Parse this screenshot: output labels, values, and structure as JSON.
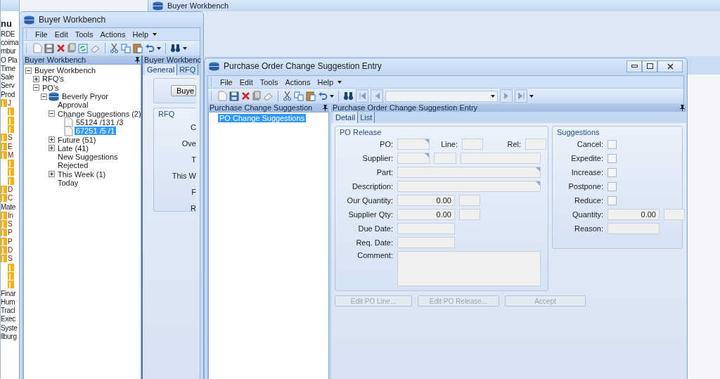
{
  "back_window": {
    "title": "Buyer Workbench"
  },
  "menu_window": {
    "title": "nu",
    "items": [
      {
        "kind": "text",
        "label": "RDE"
      },
      {
        "kind": "text",
        "label": "coima"
      },
      {
        "kind": "text",
        "label": "mbur"
      },
      {
        "kind": "text",
        "label": "O Pla"
      },
      {
        "kind": "text",
        "label": "Time"
      },
      {
        "kind": "text",
        "label": "Sale"
      },
      {
        "kind": "text",
        "label": "Serv"
      },
      {
        "kind": "text",
        "label": "Prod"
      },
      {
        "kind": "folder",
        "label": "J"
      },
      {
        "kind": "subfolder"
      },
      {
        "kind": "subfolder"
      },
      {
        "kind": "subfolder"
      },
      {
        "kind": "folder",
        "label": "S"
      },
      {
        "kind": "folder",
        "label": "E"
      },
      {
        "kind": "folder",
        "label": "M"
      },
      {
        "kind": "subfolder"
      },
      {
        "kind": "subfolder"
      },
      {
        "kind": "subfolder"
      },
      {
        "kind": "folder",
        "label": "D"
      },
      {
        "kind": "folder",
        "label": "C"
      },
      {
        "kind": "text",
        "label": "Mate"
      },
      {
        "kind": "folder",
        "label": "In"
      },
      {
        "kind": "folder",
        "label": "S"
      },
      {
        "kind": "folder",
        "label": "P"
      },
      {
        "kind": "folder",
        "label": "P"
      },
      {
        "kind": "folder",
        "label": "D"
      },
      {
        "kind": "folder",
        "label": "S"
      },
      {
        "kind": "subfolder"
      },
      {
        "kind": "subfolder"
      },
      {
        "kind": "subfolder"
      },
      {
        "kind": "text",
        "label": "Finar"
      },
      {
        "kind": "text",
        "label": "Hum"
      },
      {
        "kind": "text",
        "label": "Tracl"
      },
      {
        "kind": "text",
        "label": "Exec"
      },
      {
        "kind": "text",
        "label": "Syste"
      },
      {
        "kind": "text",
        "label": "llburg"
      }
    ]
  },
  "workbench": {
    "title": "Buyer Workbench",
    "menu": [
      "File",
      "Edit",
      "Tools",
      "Actions",
      "Help"
    ],
    "tree_header": "Buyer Workbench",
    "tree": [
      {
        "label": "Buyer Workbench",
        "expanded": true,
        "selected": false,
        "children": [
          {
            "label": "RFQ's",
            "expanded": false,
            "selected": false
          },
          {
            "label": "PO's",
            "expanded": true,
            "selected": false,
            "children": [
              {
                "label": "Beverly Pryor",
                "kind": "buyer",
                "expanded": true,
                "selected": false,
                "children": [
                  {
                    "label": "Approval",
                    "selected": false
                  },
                  {
                    "label": "Change Suggestions (2)",
                    "expanded": true,
                    "selected": false,
                    "children": [
                      {
                        "label": "55124 /131 /3",
                        "kind": "record",
                        "selected": false
                      },
                      {
                        "label": "67251 /5 /1",
                        "kind": "record",
                        "selected": true
                      }
                    ]
                  },
                  {
                    "label": "Future (51)",
                    "expanded": false,
                    "selected": false
                  },
                  {
                    "label": "Late (41)",
                    "expanded": false,
                    "selected": false
                  },
                  {
                    "label": "New Suggestions",
                    "selected": false
                  },
                  {
                    "label": "Rejected",
                    "selected": false
                  },
                  {
                    "label": "This Week (1)",
                    "expanded": false,
                    "selected": false
                  },
                  {
                    "label": "Today",
                    "selected": false
                  }
                ]
              }
            ]
          }
        ]
      }
    ],
    "panel_header": "Buyer Workbenc",
    "tabs": [
      {
        "label": "General",
        "selected": true
      },
      {
        "label": "RFQ",
        "selected": false
      }
    ],
    "button": "Buye",
    "group_title": "RFQ",
    "group_labels": [
      "C",
      "Ove",
      "T",
      "This W",
      "F",
      "R"
    ]
  },
  "dialog": {
    "title": "Purchase Order Change Suggestion Entry",
    "menu": [
      "File",
      "Edit",
      "Tools",
      "Actions",
      "Help"
    ],
    "left_header": "Purchase Change Suggestion",
    "tree": [
      {
        "label": "PO Change Suggestions",
        "selected": true
      }
    ],
    "right_header": "Purchase Order Change Suggestion Entry",
    "tabs": [
      {
        "label": "Detail",
        "selected": true
      },
      {
        "label": "List",
        "selected": false
      }
    ],
    "po_release": {
      "title": "PO Release",
      "po_label": "PO:",
      "line_label": "Line:",
      "rel_label": "Rel:",
      "supplier_label": "Supplier:",
      "part_label": "Part:",
      "description_label": "Description:",
      "our_quantity": {
        "label": "Our Quantity:",
        "value": "0.00"
      },
      "supplier_qty": {
        "label": "Supplier Qty:",
        "value": "0.00"
      },
      "due_date_label": "Due Date:",
      "req_date_label": "Req. Date:",
      "comment_label": "Comment:"
    },
    "suggestions": {
      "title": "Suggestions",
      "checks": [
        {
          "label": "Cancel:",
          "checked": false
        },
        {
          "label": "Expedite:",
          "checked": false
        },
        {
          "label": "Increase:",
          "checked": false
        },
        {
          "label": "Postpone:",
          "checked": false
        },
        {
          "label": "Reduce:",
          "checked": false
        }
      ],
      "quantity": {
        "label": "Quantity:",
        "value": "0.00"
      },
      "reason_label": "Reason:"
    },
    "buttons": [
      {
        "label": "Edit PO Line...",
        "disabled": true
      },
      {
        "label": "Edit PO Release...",
        "disabled": true
      },
      {
        "label": "Accept",
        "disabled": true
      }
    ]
  }
}
